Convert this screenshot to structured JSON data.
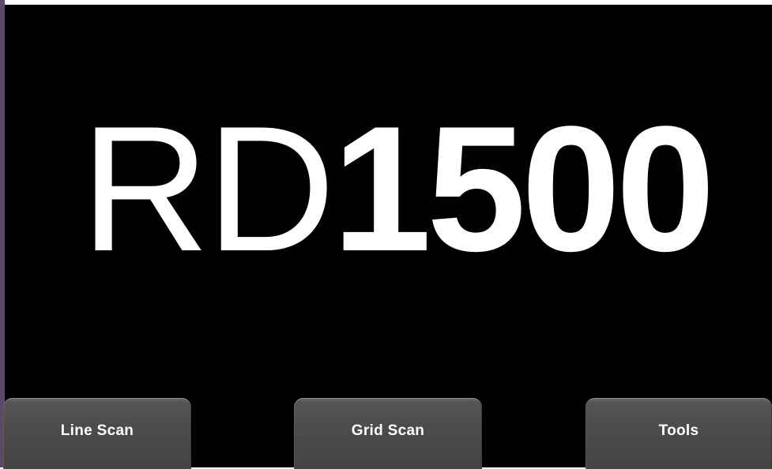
{
  "logo": {
    "prefix": "RD",
    "model": "1500"
  },
  "softkeys": [
    {
      "label": "Line Scan"
    },
    {
      "label": "Grid Scan"
    },
    {
      "label": "Tools"
    }
  ],
  "colors": {
    "background": "#000000",
    "text": "#ffffff",
    "button": "#4c4c4c"
  }
}
